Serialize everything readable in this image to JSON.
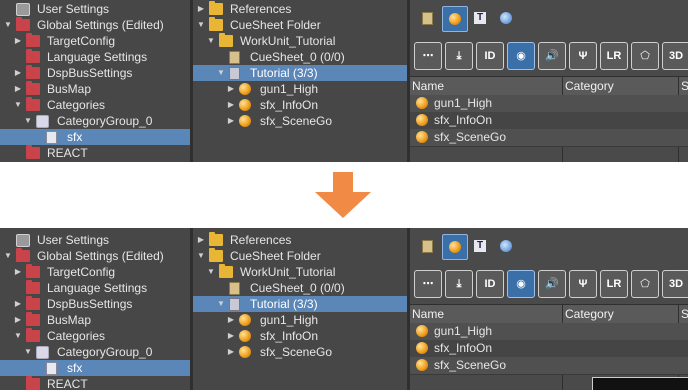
{
  "colors": {
    "arrow": "#f08a45",
    "selection": "#5a86b8",
    "panel": "#474747"
  },
  "left_tree": [
    {
      "label": "User Settings",
      "icon": "gear-icon",
      "indent": 0,
      "twisty": ""
    },
    {
      "label": "Global Settings (Edited)",
      "icon": "red-folder-open-icon",
      "indent": 0,
      "twisty": "▼"
    },
    {
      "label": "TargetConfig",
      "icon": "red-folder-icon",
      "indent": 1,
      "twisty": "▶"
    },
    {
      "label": "Language Settings",
      "icon": "red-folder-icon",
      "indent": 1,
      "twisty": ""
    },
    {
      "label": "DspBusSettings",
      "icon": "red-folder-icon",
      "indent": 1,
      "twisty": "▶"
    },
    {
      "label": "BusMap",
      "icon": "red-folder-icon",
      "indent": 1,
      "twisty": "▶"
    },
    {
      "label": "Categories",
      "icon": "red-folder-open-icon",
      "indent": 1,
      "twisty": "▼"
    },
    {
      "label": "CategoryGroup_0",
      "icon": "category-group-icon",
      "indent": 2,
      "twisty": "▼"
    },
    {
      "label": "sfx",
      "icon": "category-list-icon",
      "indent": 3,
      "twisty": "",
      "selected": true
    },
    {
      "label": "REACT",
      "icon": "red-folder-icon",
      "indent": 1,
      "twisty": ""
    }
  ],
  "mid_tree": [
    {
      "label": "References",
      "icon": "yellow-folder-icon",
      "indent": 0,
      "twisty": "▶"
    },
    {
      "label": "CueSheet Folder",
      "icon": "yellow-folder-open-icon",
      "indent": 0,
      "twisty": "▼"
    },
    {
      "label": "WorkUnit_Tutorial",
      "icon": "yellow-folder-open-icon",
      "indent": 1,
      "twisty": "▼"
    },
    {
      "label": "CueSheet_0 (0/0)",
      "icon": "cuesheet-icon",
      "indent": 2,
      "twisty": ""
    },
    {
      "label": "Tutorial (3/3)",
      "icon": "cuesheet-selected-icon",
      "indent": 2,
      "twisty": "▼",
      "selected": true
    },
    {
      "label": "gun1_High",
      "icon": "cue-orb-icon",
      "indent": 3,
      "twisty": "▶"
    },
    {
      "label": "sfx_InfoOn",
      "icon": "cue-orb-icon",
      "indent": 3,
      "twisty": "▶"
    },
    {
      "label": "sfx_SceneGo",
      "icon": "cue-orb-icon",
      "indent": 3,
      "twisty": "▶"
    }
  ],
  "toolbar_top": [
    {
      "icon": "cuesheet-tool-icon",
      "active": false
    },
    {
      "icon": "cue-orb-tool-icon",
      "active": true
    },
    {
      "icon": "text-tool-icon",
      "label": "T",
      "active": false
    },
    {
      "icon": "globe-tool-icon",
      "active": false
    }
  ],
  "toolbar_bottom": [
    {
      "icon": "speech-bubble-icon",
      "label": "⋯",
      "active": false
    },
    {
      "icon": "download-tray-icon",
      "label": "⤓",
      "active": false
    },
    {
      "icon": "id-icon",
      "label": "ID",
      "active": false
    },
    {
      "icon": "record-icon",
      "label": "◉",
      "active": true
    },
    {
      "icon": "speaker-icon",
      "label": "🔊",
      "active": false
    },
    {
      "icon": "tuning-fork-icon",
      "label": "Ψ",
      "active": false
    },
    {
      "icon": "pan-lr-icon",
      "label": "LR",
      "active": false
    },
    {
      "icon": "pentagon-icon",
      "label": "⬠",
      "active": false
    },
    {
      "icon": "3d-icon",
      "label": "3D",
      "active": false
    }
  ],
  "table": {
    "headers": [
      "Name",
      "Category",
      "S"
    ],
    "rows": [
      "gun1_High",
      "sfx_InfoOn",
      "sfx_SceneGo"
    ]
  }
}
